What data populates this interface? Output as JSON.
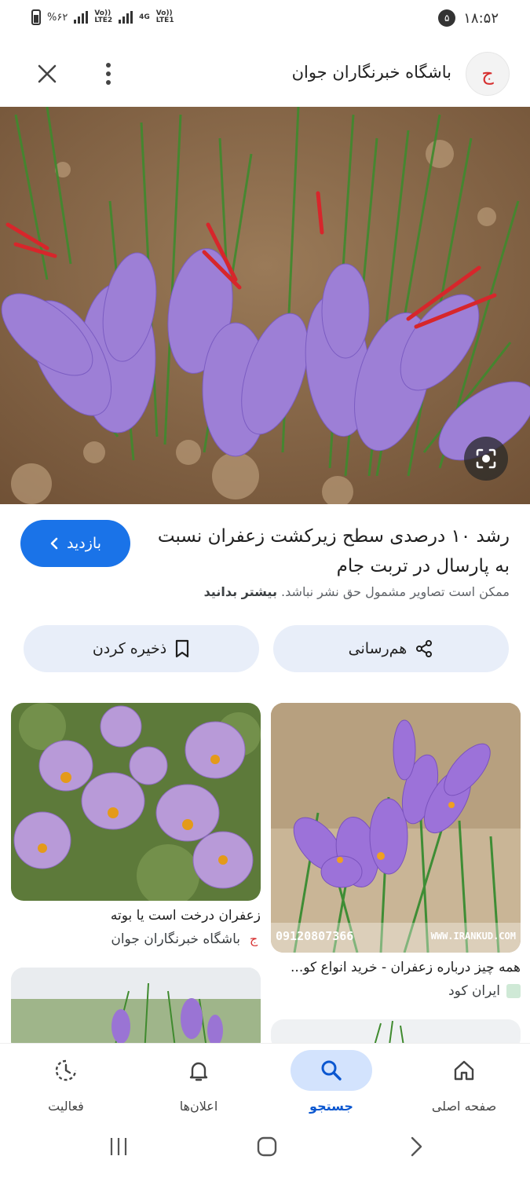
{
  "status_bar": {
    "battery": "%۶۲",
    "net1": "Vo))\nLTE2",
    "net2": "4G",
    "net3": "Vo))\nLTE1",
    "time": "۱۸:۵۲",
    "notification_count": "۵"
  },
  "header": {
    "site_name": "باشگاه خبرنگاران جوان",
    "logo_text": "ج"
  },
  "result": {
    "title": "رشد ۱۰ درصدی سطح زیرکشت زعفران نسبت به پارسال در تربت جام",
    "visit_label": "بازدید",
    "copyright_text": "ممکن است تصاویر مشمول حق نشر نباشد.",
    "learn_more": "بیشتر بدانید"
  },
  "actions": {
    "share_label": "هم‌رسانی",
    "save_label": "ذخیره کردن"
  },
  "related": [
    {
      "caption": "همه چیز درباره زعفران - خرید انواع کو...",
      "source": "ایران کود",
      "watermark_left": "09120807366",
      "watermark_right": "WWW.IRANKUD.COM"
    },
    {
      "caption": "زعفران درخت است یا بوته",
      "source": "باشگاه خبرنگاران جوان"
    }
  ],
  "nav": {
    "home": "صفحه اصلی",
    "search": "جستجو",
    "notifications": "اعلان‌ها",
    "activity": "فعالیت"
  },
  "colors": {
    "accent": "#1a73e8",
    "pill_bg": "#e8eef9",
    "nav_active": "#d3e3fd"
  }
}
